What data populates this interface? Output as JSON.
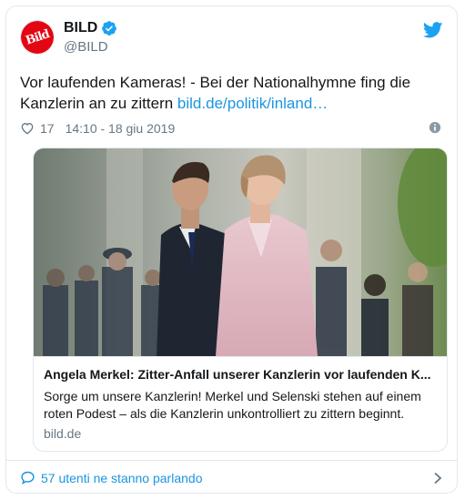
{
  "account": {
    "display_name": "BILD",
    "handle": "@BILD",
    "avatar_text": "Bild",
    "brand_color": "#e30613",
    "verified": true
  },
  "tweet": {
    "text": "Vor laufenden Kameras! - Bei der Nationalhymne fing die Kanzlerin an zu zittern ",
    "link_text": "bild.de/politik/inland…",
    "like_count": "17",
    "timestamp": "14:10 - 18 giu 2019"
  },
  "card": {
    "title": "Angela Merkel: Zitter-Anfall unserer Kanzlerin vor laufenden K...",
    "description": "Sorge um unsere Kanzlerin! Merkel und Selenski stehen auf einem roten Podest – als die Kanzlerin unkontrolliert zu zittern beginnt.",
    "domain": "bild.de"
  },
  "footer": {
    "discussion": "57 utenti ne stanno parlando"
  },
  "colors": {
    "link": "#1b95e0",
    "secondary_text": "#657786",
    "border": "#e1e8ed",
    "twitter_blue": "#1da1f2"
  },
  "icons": [
    "twitter-bird-icon",
    "verified-badge-icon",
    "heart-icon",
    "info-icon",
    "speech-bubble-icon",
    "chevron-right-icon"
  ]
}
